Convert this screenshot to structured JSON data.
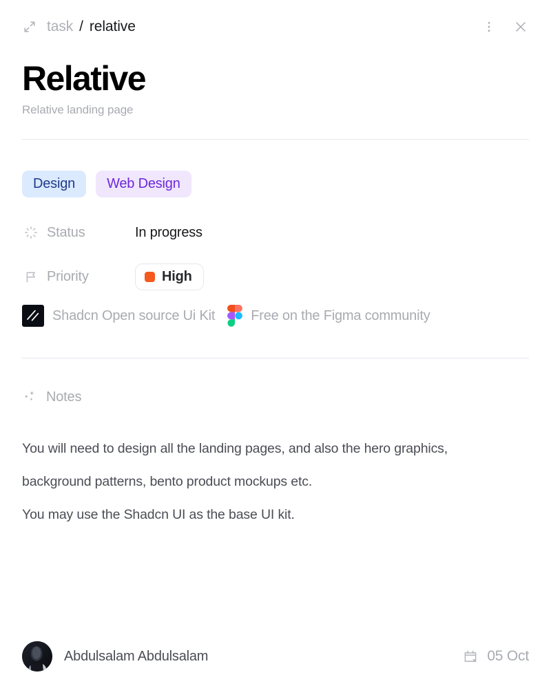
{
  "header": {
    "expand_icon": "expand-diagonal-icon",
    "breadcrumb": {
      "root": "task",
      "separator": "/",
      "current": "relative"
    },
    "more_icon": "more-vertical-icon",
    "close_icon": "close-icon"
  },
  "title": {
    "heading": "Relative",
    "subtitle": "Relative landing page"
  },
  "tags": [
    {
      "label": "Design",
      "bg": "#dbeafe",
      "fg": "#1e3a8a"
    },
    {
      "label": "Web Design",
      "bg": "#f0e7fd",
      "fg": "#6d28d9"
    }
  ],
  "fields": {
    "status": {
      "icon": "loader-spinner-icon",
      "label": "Status",
      "value": "In progress"
    },
    "priority": {
      "icon": "flag-icon",
      "label": "Priority",
      "value": "High",
      "swatch_color": "#f4591e"
    }
  },
  "links": [
    {
      "icon": "shadcn-logo-icon",
      "text": "Shadcn Open source Ui Kit"
    },
    {
      "icon": "figma-logo-icon",
      "text": "Free on the Figma community"
    }
  ],
  "notes": {
    "icon": "sparkles-icon",
    "label": "Notes",
    "paragraphs": [
      "You will need to design all the landing pages, and also the hero graphics, background patterns, bento product mockups etc.",
      "You may use the Shadcn UI as the base UI kit."
    ]
  },
  "footer": {
    "assignee": {
      "avatar_icon": "user-avatar",
      "name": "Abdulsalam Abdulsalam"
    },
    "due": {
      "icon": "calendar-x-icon",
      "date": "05 Oct"
    }
  },
  "colors": {
    "divider": "#e4e7ec",
    "muted_text": "#a9abb1",
    "body_text": "#4b4d55",
    "title_text": "#000000",
    "priority_orange": "#f4591e"
  }
}
